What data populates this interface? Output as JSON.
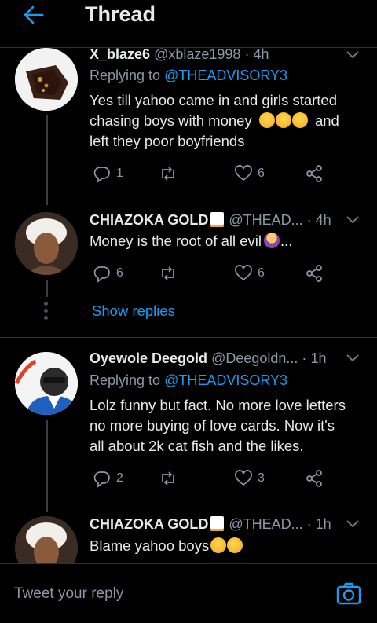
{
  "header": {
    "title": "Thread"
  },
  "tweets": [
    {
      "name": "X_blaze6",
      "handle": "@xblaze1998",
      "time": "4h",
      "replying_prefix": "Replying to",
      "replying_to": "@THEADVISORY3",
      "line1": "Yes till yahoo came in and girls started",
      "line2_pre": "chasing boys with money",
      "line2_post": "and",
      "line3": "left they poor boyfriends",
      "replies": "1",
      "retweets": "",
      "likes": "6"
    },
    {
      "name": "CHIAZOKA GOLD",
      "handle": "@THEAD...",
      "time": "4h",
      "text": "Money is the root of all evil",
      "text_suffix": "...",
      "replies": "6",
      "retweets": "",
      "likes": "6"
    },
    {
      "name": "Oyewole Deegold",
      "handle": "@Deegoldn...",
      "time": "1h",
      "replying_prefix": "Replying to",
      "replying_to": "@THEADVISORY3",
      "line1": "Lolz funny but fact. No more love letters",
      "line2": "no more buying of love cards. Now it's",
      "line3": "all about 2k cat fish and the likes.",
      "replies": "2",
      "retweets": "",
      "likes": "3"
    },
    {
      "name": "CHIAZOKA GOLD",
      "handle": "@THEAD...",
      "time": "1h",
      "text": "Blame yahoo boys"
    }
  ],
  "show_replies": "Show replies",
  "composer": {
    "placeholder": "Tweet your reply"
  },
  "colors": {
    "accent": "#1d9bf0",
    "muted": "#8b98a5",
    "background": "#000000",
    "divider": "#2f3336"
  },
  "icons": [
    "back-arrow-icon",
    "chevron-down-icon",
    "reply-icon",
    "retweet-icon",
    "like-icon",
    "share-icon",
    "camera-icon",
    "memo-emoji",
    "laughing-emoji",
    "facepalm-emoji",
    "rofl-emoji"
  ]
}
